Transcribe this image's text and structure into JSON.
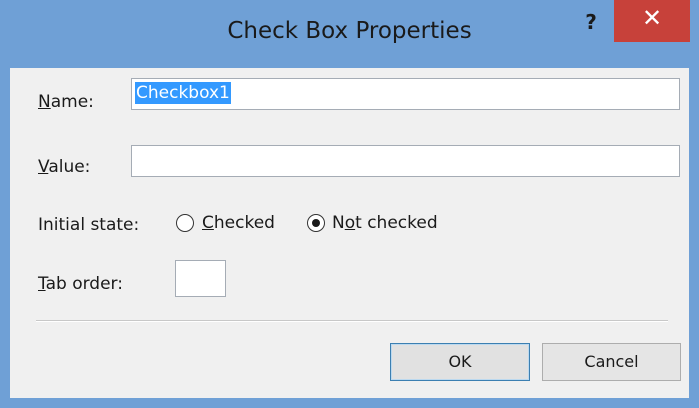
{
  "window": {
    "title": "Check Box Properties",
    "help_label": "?",
    "close_label": "✕"
  },
  "fields": {
    "name": {
      "label_prefix": "",
      "label_mnemonic": "N",
      "label_rest": "ame:",
      "value": "Checkbox1"
    },
    "value": {
      "label_prefix": "",
      "label_mnemonic": "V",
      "label_rest": "alue:",
      "value": ""
    },
    "initial_state": {
      "label": "Initial state:",
      "options": [
        {
          "prefix": "",
          "mnemonic": "C",
          "rest": "hecked",
          "selected": false
        },
        {
          "prefix": "N",
          "mnemonic": "o",
          "rest": "t checked",
          "selected": true
        }
      ]
    },
    "tab_order": {
      "label_prefix": "",
      "label_mnemonic": "T",
      "label_rest": "ab order:",
      "value": ""
    }
  },
  "buttons": {
    "ok": "OK",
    "cancel": "Cancel"
  },
  "colors": {
    "frame": "#6fa0d6",
    "close": "#c7413a",
    "selection": "#3399ff"
  }
}
